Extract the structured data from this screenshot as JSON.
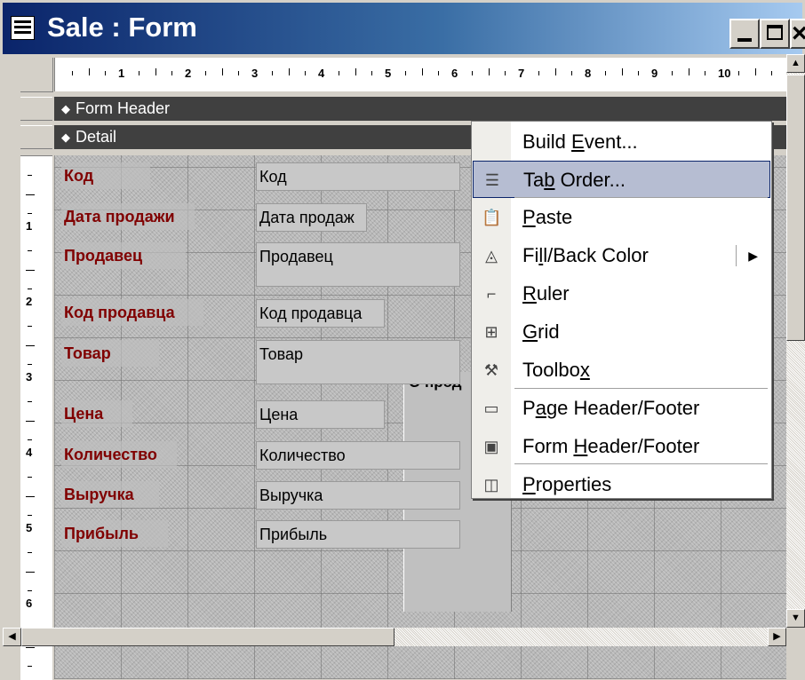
{
  "window": {
    "title": "Sale : Form",
    "icon": "form-icon",
    "controls": {
      "minimize": "_",
      "maximize": "□",
      "close": "×"
    }
  },
  "ruler": {
    "horizontal_numbers": [
      "1",
      "2",
      "3",
      "4",
      "5",
      "6",
      "7",
      "8",
      "9",
      "10"
    ],
    "vertical_numbers": [
      "1",
      "2",
      "3",
      "4",
      "5",
      "6"
    ]
  },
  "sections": {
    "form_header": "Form Header",
    "detail": "Detail"
  },
  "fields": [
    {
      "label": "Код",
      "value": "Код"
    },
    {
      "label": "Дата продажи",
      "value": "Дата продаж"
    },
    {
      "label": "Продавец",
      "value": "Продавец"
    },
    {
      "label": "Код продавца",
      "value": "Код продавца"
    },
    {
      "label": "Товар",
      "value": "Товар"
    },
    {
      "label": "Цена",
      "value": "Цена"
    },
    {
      "label": "Количество",
      "value": "Количество"
    },
    {
      "label": "Выручка",
      "value": "Выручка"
    },
    {
      "label": "Прибыль",
      "value": "Прибыль"
    }
  ],
  "subform": {
    "label": "О прод"
  },
  "context_menu": {
    "items": [
      {
        "label": "Build Event...",
        "pre": "Build ",
        "u": "E",
        "post": "vent...",
        "icon": "blank-icon"
      },
      {
        "label": "Tab Order...",
        "pre": "Ta",
        "u": "b",
        "post": " Order...",
        "icon": "tab-order-icon",
        "highlighted": true
      },
      {
        "label": "Paste",
        "pre": "",
        "u": "P",
        "post": "aste",
        "icon": "paste-icon"
      },
      {
        "label": "Fill/Back Color",
        "pre": "Fi",
        "u": "l",
        "post": "l/Back Color",
        "icon": "fill-color-icon",
        "submenu": true
      },
      {
        "label": "Ruler",
        "pre": "",
        "u": "R",
        "post": "uler",
        "icon": "ruler-icon"
      },
      {
        "label": "Grid",
        "pre": "",
        "u": "G",
        "post": "rid",
        "icon": "grid-icon"
      },
      {
        "label": "Toolbox",
        "pre": "Toolbo",
        "u": "x",
        "post": "",
        "icon": "toolbox-icon"
      },
      {
        "label": "Page Header/Footer",
        "pre": "P",
        "u": "a",
        "post": "ge Header/Footer",
        "icon": "page-header-icon"
      },
      {
        "label": "Form Header/Footer",
        "pre": "Form ",
        "u": "H",
        "post": "eader/Footer",
        "icon": "form-header-icon"
      },
      {
        "label": "Properties",
        "pre": "",
        "u": "P",
        "post": "roperties",
        "icon": "properties-icon"
      }
    ]
  },
  "scrollbars": {
    "up": "▲",
    "down": "▼",
    "left": "◀",
    "right": "▶"
  }
}
